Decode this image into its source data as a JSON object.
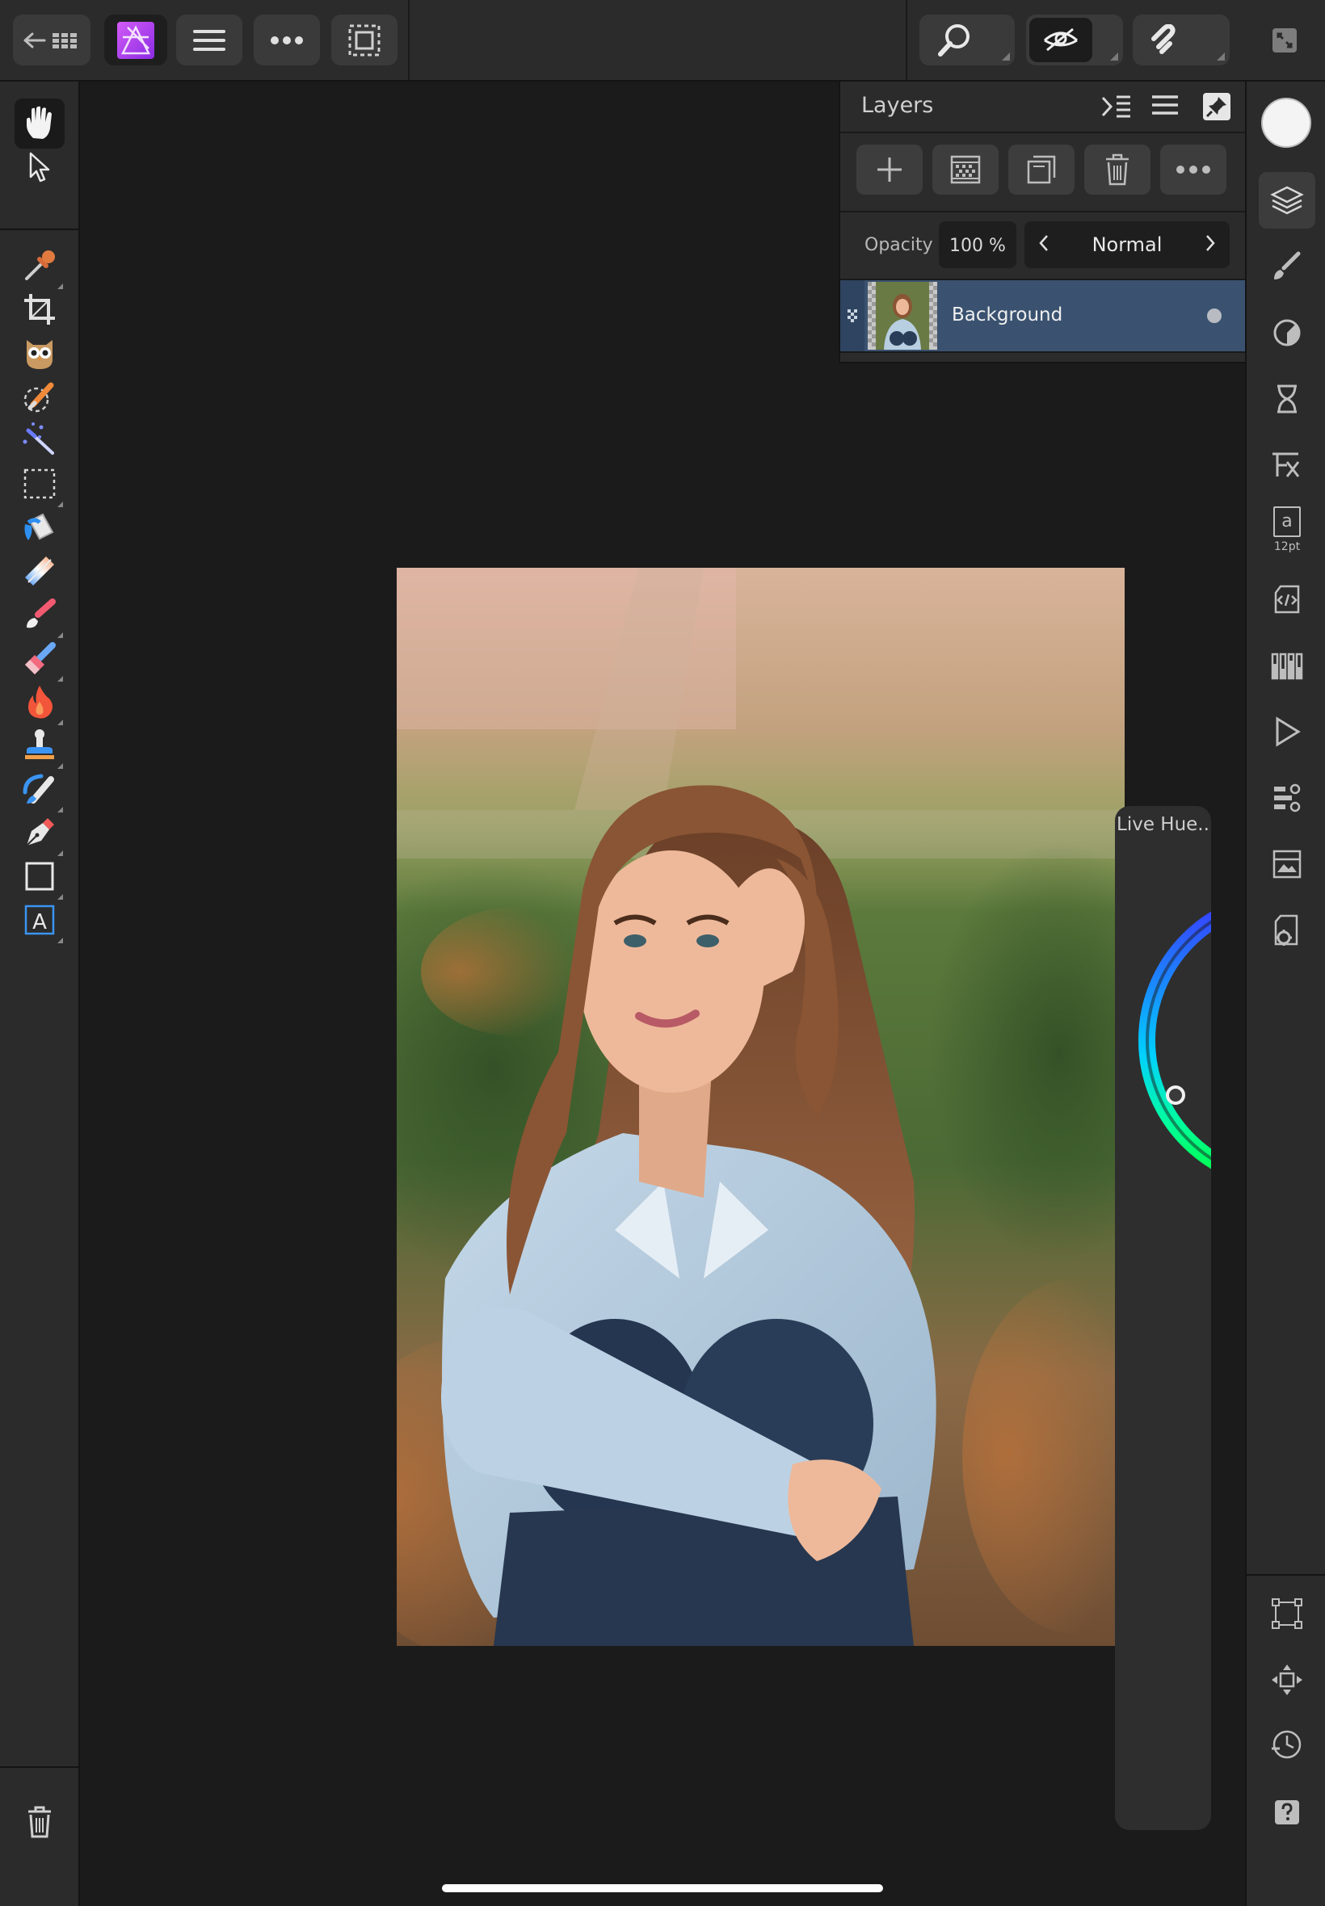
{
  "app": {
    "name": "Affinity Photo",
    "accent": "#a63ee8"
  },
  "topbar": {
    "buttons": [
      {
        "name": "back-to-documents-button",
        "icon": "back-grid-icon"
      },
      {
        "name": "persona-photo-button",
        "icon": "affinity-photo-logo-icon"
      },
      {
        "name": "document-menu-button",
        "icon": "hamburger-icon"
      },
      {
        "name": "more-options-button",
        "icon": "ellipsis-icon"
      },
      {
        "name": "selection-mode-button",
        "icon": "marquee-icon"
      },
      {
        "name": "zoom-button",
        "icon": "magnifier-icon"
      },
      {
        "name": "view-mode-button",
        "icon": "eye-icon"
      },
      {
        "name": "snapping-button",
        "icon": "magnet-icon"
      },
      {
        "name": "fullscreen-button",
        "icon": "expand-icon"
      }
    ]
  },
  "tools": [
    {
      "name": "view-tool",
      "icon": "hand-icon",
      "active": true
    },
    {
      "name": "move-tool",
      "icon": "pointer-arrow-icon"
    },
    {
      "name": "color-picker-tool",
      "icon": "eyedropper-icon"
    },
    {
      "name": "crop-tool",
      "icon": "crop-icon"
    },
    {
      "name": "red-eye-tool",
      "icon": "owl-icon"
    },
    {
      "name": "selection-brush-tool",
      "icon": "selection-brush-icon"
    },
    {
      "name": "flood-select-tool",
      "icon": "magic-wand-icon"
    },
    {
      "name": "marquee-tool",
      "icon": "dashed-rect-icon"
    },
    {
      "name": "fill-tool",
      "icon": "paint-bucket-icon"
    },
    {
      "name": "gradient-tool",
      "icon": "gradient-icon"
    },
    {
      "name": "paint-brush-tool",
      "icon": "brush-icon"
    },
    {
      "name": "erase-brush-tool",
      "icon": "eraser-icon"
    },
    {
      "name": "dodge-burn-tool",
      "icon": "flame-icon"
    },
    {
      "name": "clone-tool",
      "icon": "stamp-icon"
    },
    {
      "name": "smudge-tool",
      "icon": "smudge-icon"
    },
    {
      "name": "pen-tool",
      "icon": "pen-nib-icon"
    },
    {
      "name": "rectangle-tool",
      "icon": "rectangle-icon"
    },
    {
      "name": "artistic-text-tool",
      "icon": "text-frame-icon"
    }
  ],
  "layers_panel": {
    "title": "Layers",
    "opacity_label": "Opacity",
    "opacity_value": "100 %",
    "blend_mode": "Normal",
    "layers": [
      {
        "name": "Background",
        "visible": true
      }
    ]
  },
  "studio": {
    "text_size": "12pt",
    "text_glyph": "a"
  },
  "live_hue": {
    "title": "Live Hue..."
  }
}
